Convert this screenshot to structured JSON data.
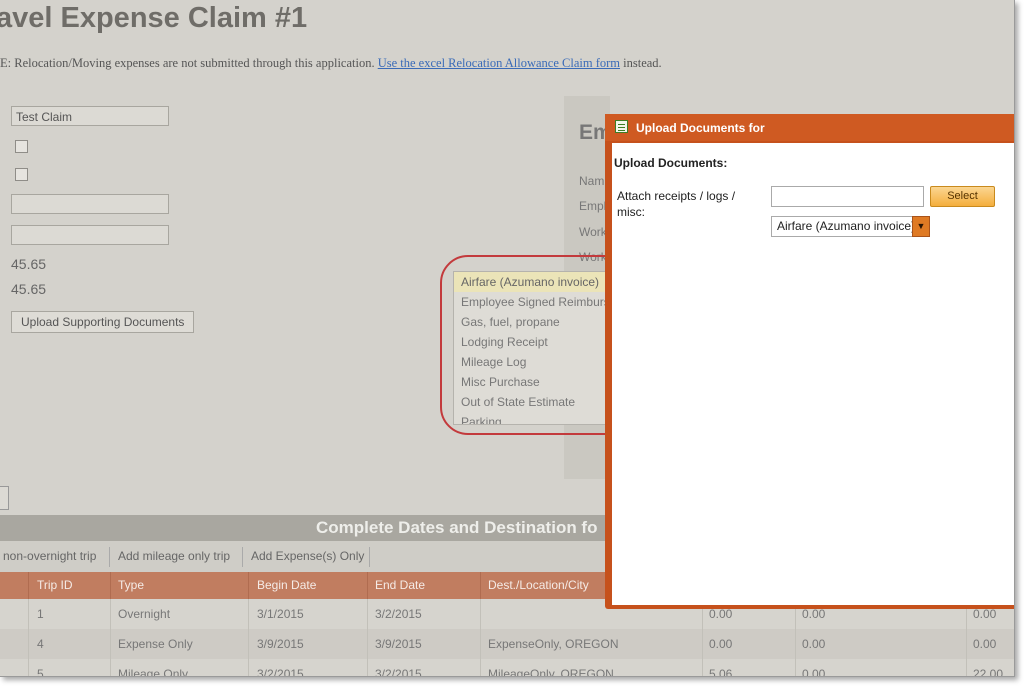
{
  "page": {
    "title": "avel Expense Claim #1",
    "note_prefix": "E: Relocation/Moving expenses are not submitted through this application. ",
    "note_link": "Use the excel Relocation Allowance Claim form",
    "note_suffix": " instead."
  },
  "form": {
    "claim_name": "Test Claim",
    "amount_1": "45.65",
    "amount_2": "45.65",
    "upload_button": "Upload Supporting Documents"
  },
  "employee_panel": {
    "title": "Em",
    "labels": [
      "Nam",
      "Empl",
      "Work",
      "Work"
    ]
  },
  "doc_types": {
    "selected": "Airfare (Azumano invoice)",
    "items": [
      "Airfare (Azumano invoice)",
      "Employee Signed Reimburs",
      "Gas, fuel, propane",
      "Lodging Receipt",
      "Mileage Log",
      "Misc Purchase",
      "Out of State Estimate",
      "Parking"
    ]
  },
  "trips": {
    "section_title": "Complete Dates and Destination fo",
    "actions": [
      "non-overnight trip",
      "Add mileage only trip",
      "Add Expense(s) Only"
    ],
    "columns": [
      "Trip ID",
      "Type",
      "Begin Date",
      "End Date",
      "Dest./Location/City"
    ],
    "rows": [
      {
        "id": "1",
        "type": "Overnight",
        "begin": "3/1/2015",
        "end": "3/2/2015",
        "dest": "",
        "c1": "0.00",
        "c2": "0.00",
        "c3": "0.00"
      },
      {
        "id": "4",
        "type": "Expense Only",
        "begin": "3/9/2015",
        "end": "3/9/2015",
        "dest": "ExpenseOnly, OREGON",
        "c1": "0.00",
        "c2": "0.00",
        "c3": "0.00"
      },
      {
        "id": "5",
        "type": "Mileage Only",
        "begin": "3/2/2015",
        "end": "3/2/2015",
        "dest": "MileageOnly, OREGON",
        "c1": "5.06",
        "c2": "0.00",
        "c3": "22.00"
      }
    ]
  },
  "dialog": {
    "title": "Upload Documents for",
    "heading": "Upload Documents:",
    "attach_label": "Attach receipts / logs / misc:",
    "file_value": "",
    "select_button": "Select",
    "doc_type_value": "Airfare (Azumano invoice)"
  },
  "colors": {
    "dialog_frame": "#c6511c",
    "table_header": "#c17d60",
    "select_button": "#f4ae3d",
    "highlight_circle": "#c33a3c"
  }
}
